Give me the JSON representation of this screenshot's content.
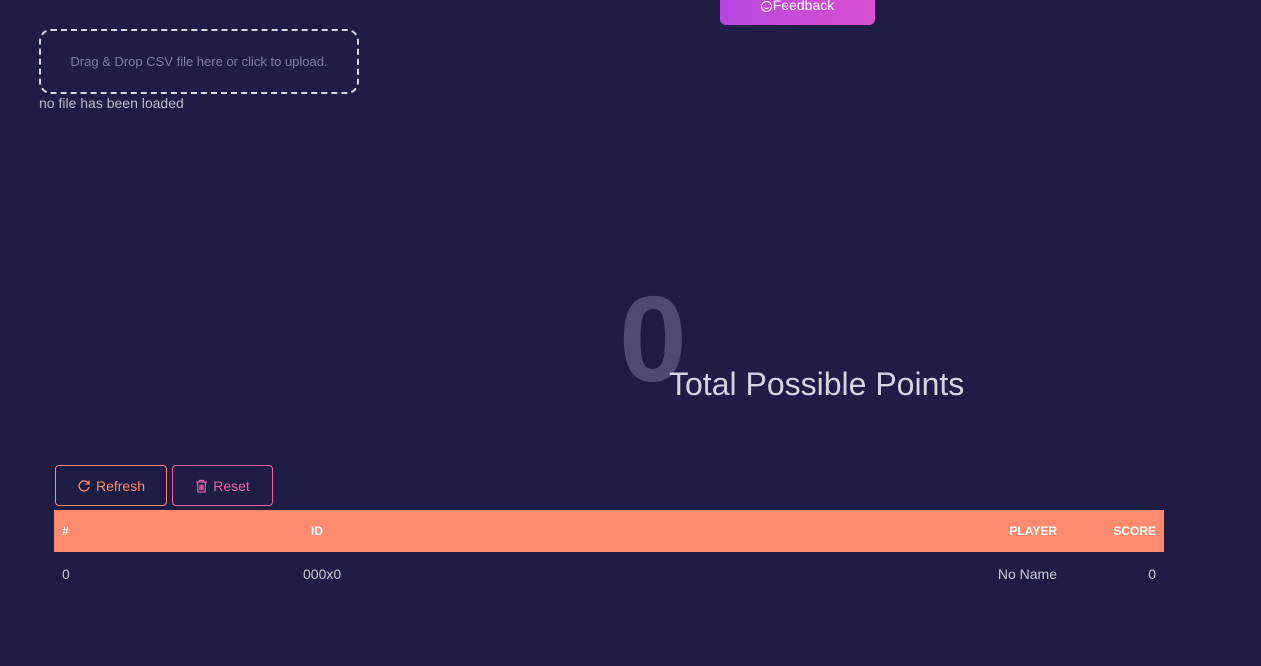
{
  "feedback": {
    "label": "Feedback",
    "icon": "smile-icon"
  },
  "upload": {
    "prompt": "Drag & Drop CSV file here or click to upload.",
    "status": "no file has been loaded"
  },
  "total": {
    "value": "0",
    "label": "Total Possible Points"
  },
  "actions": {
    "refresh_label": "Refresh",
    "refresh_icon": "refresh-icon",
    "reset_label": "Reset",
    "reset_icon": "trash-icon"
  },
  "table": {
    "headers": {
      "num": "#",
      "id": "ID",
      "player": "PLAYER",
      "score": "SCORE"
    },
    "rows": [
      {
        "num": "0",
        "id": "000x0",
        "player": "No Name",
        "score": "0"
      }
    ]
  },
  "colors": {
    "background": "#1c1c44",
    "accent_orange": "#ff8a6d",
    "accent_pink": "#ef5fa7",
    "feedback_gradient_start": "#b548e0",
    "feedback_gradient_end": "#d94fd0"
  }
}
